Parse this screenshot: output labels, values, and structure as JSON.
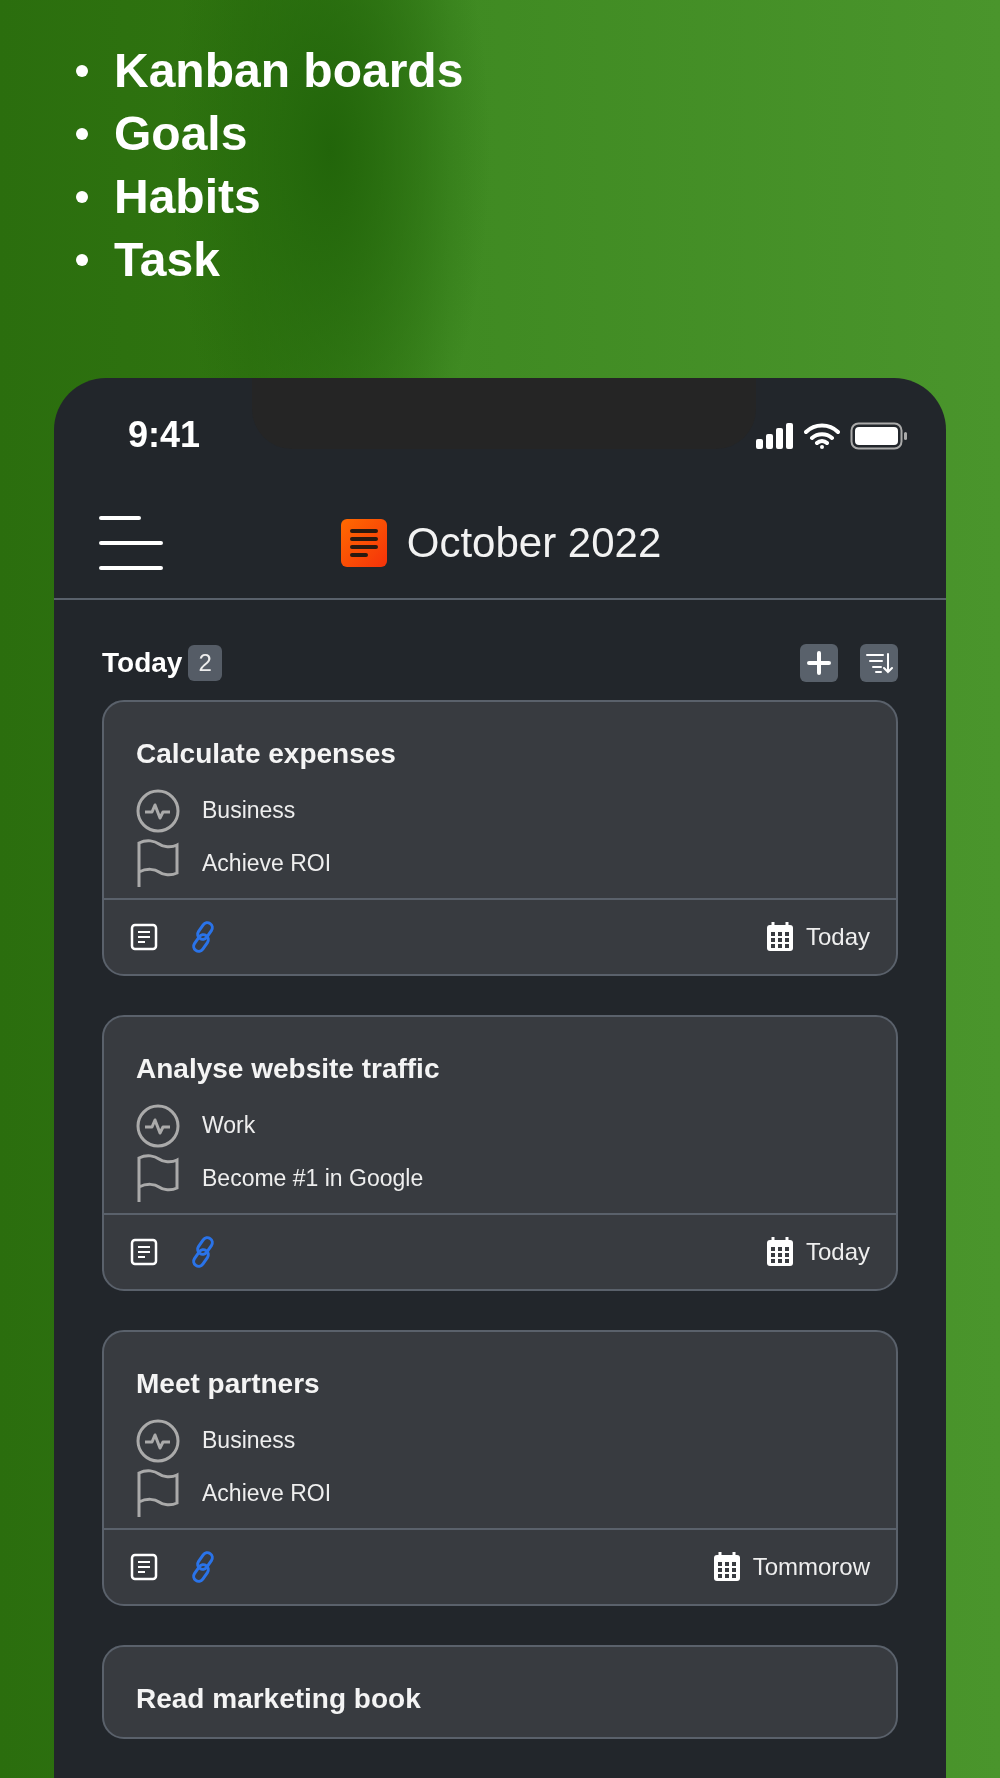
{
  "features": [
    "Kanban boards",
    "Goals",
    "Habits",
    "Task"
  ],
  "status_bar": {
    "time": "9:41"
  },
  "header": {
    "title": "October 2022"
  },
  "section": {
    "title": "Today",
    "count": "2"
  },
  "cards": [
    {
      "title": "Calculate expenses",
      "area": "Business",
      "goal": "Achieve ROI",
      "due": "Today"
    },
    {
      "title": "Analyse website traffic",
      "area": "Work",
      "goal": "Become #1 in Google",
      "due": "Today"
    },
    {
      "title": "Meet partners",
      "area": "Business",
      "goal": "Achieve ROI",
      "due": "Tommorow"
    },
    {
      "title": "Read marketing book"
    }
  ]
}
